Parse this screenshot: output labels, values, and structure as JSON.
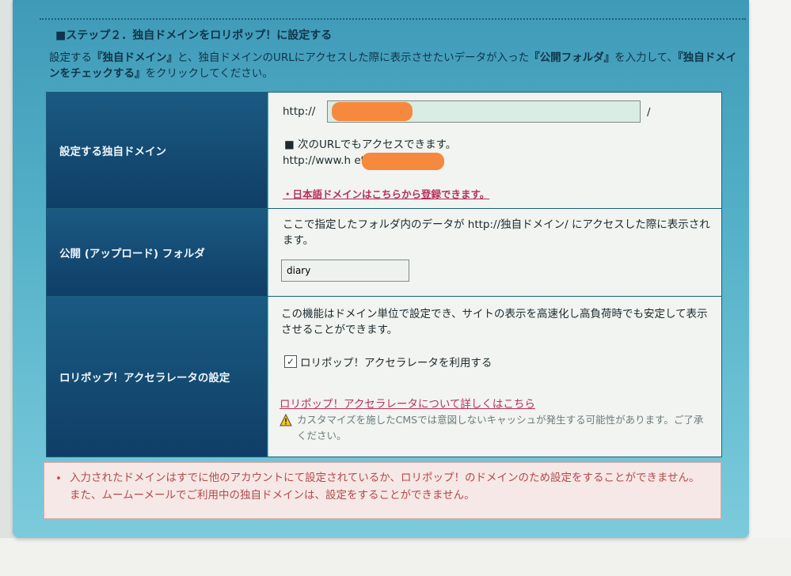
{
  "step_title": "■ステップ２．独自ドメインをロリポップ！に設定する",
  "instructions": {
    "part1": "設定する",
    "term1": "『独自ドメイン』",
    "part2": "と、独自ドメインのURLにアクセスした際に表示させたいデータが入った",
    "term2": "『公開フォルダ』",
    "part3": "を入力して、",
    "term3": "『独自ドメインをチェックする』",
    "part4": "をクリックしてください。"
  },
  "domain_row": {
    "label": "設定する独自ドメイン",
    "prefix": "http://",
    "input_value": "h",
    "suffix": "/",
    "also_note": "■ 次のURLでもアクセスできます。",
    "also_url": "http://www.h                    et",
    "jp_link": "・日本語ドメインはこちらから登録できます。"
  },
  "folder_row": {
    "label": "公開 (アップロード) フォルダ",
    "description": "ここで指定したフォルダ内のデータが http://独自ドメイン/ にアクセスした際に表示されます。",
    "input_value": "diary"
  },
  "accel_row": {
    "label": "ロリポップ！アクセラレータの設定",
    "description": "この機能はドメイン単位で設定でき、サイトの表示を高速化し高負荷時でも安定して表示させることができます。",
    "checkbox_label": "ロリポップ！アクセラレータを利用する",
    "checked": true,
    "more_link": "ロリポップ！アクセラレータについて詳しくはこちら",
    "warning": "カスタマイズを施したCMSでは意図しないキャッシュが発生する可能性があります。ご了承ください。"
  },
  "error_message": "入力されたドメインはすでに他のアカウントにて設定されているか、ロリポップ！のドメインのため設定をすることができません。また、ムームーメールでご利用中の独自ドメインは、設定をすることができません。",
  "colors": {
    "panel": "#56b2c9",
    "label_bg": "#0f3e66",
    "link": "#b8305c",
    "error_text": "#b14b4b",
    "redaction": "#f58a3e"
  }
}
